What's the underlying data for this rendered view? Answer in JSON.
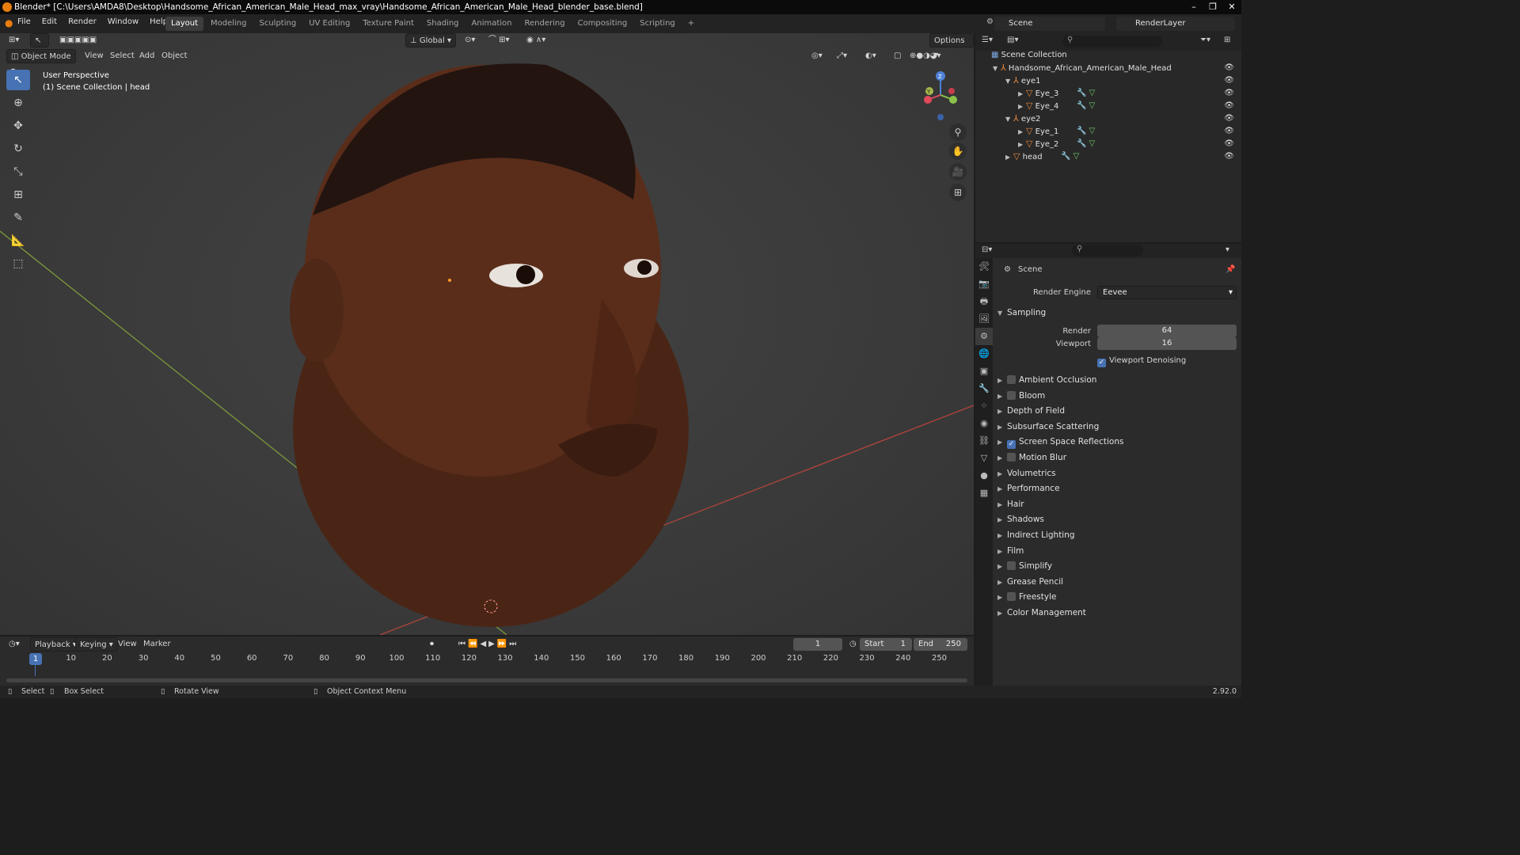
{
  "window": {
    "title": "Blender* [C:\\Users\\AMDA8\\Desktop\\Handsome_African_American_Male_Head_max_vray\\Handsome_African_American_Male_Head_blender_base.blend]"
  },
  "menu": [
    "File",
    "Edit",
    "Render",
    "Window",
    "Help"
  ],
  "workspaces": [
    "Layout",
    "Modeling",
    "Sculpting",
    "UV Editing",
    "Texture Paint",
    "Shading",
    "Animation",
    "Rendering",
    "Compositing",
    "Scripting"
  ],
  "scene_name": "Scene",
  "render_layer": "RenderLayer",
  "viewport": {
    "mode": "Object Mode",
    "menus": [
      "View",
      "Select",
      "Add",
      "Object"
    ],
    "transform_orientation": "Global",
    "options_label": "Options",
    "info_line1": "User Perspective",
    "info_line2": "(1) Scene Collection | head"
  },
  "outliner": {
    "root": "Scene Collection",
    "rows": [
      {
        "label": "Handsome_African_American_Male_Head"
      },
      {
        "label": "eye1"
      },
      {
        "label": "Eye_3"
      },
      {
        "label": "Eye_4"
      },
      {
        "label": "eye2"
      },
      {
        "label": "Eye_1"
      },
      {
        "label": "Eye_2"
      },
      {
        "label": "head"
      }
    ]
  },
  "properties": {
    "context": "Scene",
    "render_engine_label": "Render Engine",
    "render_engine": "Eevee",
    "sampling_label": "Sampling",
    "render_label": "Render",
    "render_value": "64",
    "viewport_label": "Viewport",
    "viewport_value": "16",
    "viewport_denoising": "Viewport Denoising",
    "panels": [
      {
        "label": "Ambient Occlusion",
        "checkbox": true,
        "checked": false
      },
      {
        "label": "Bloom",
        "checkbox": true,
        "checked": false
      },
      {
        "label": "Depth of Field",
        "checkbox": false
      },
      {
        "label": "Subsurface Scattering",
        "checkbox": false
      },
      {
        "label": "Screen Space Reflections",
        "checkbox": true,
        "checked": true
      },
      {
        "label": "Motion Blur",
        "checkbox": true,
        "checked": false
      },
      {
        "label": "Volumetrics",
        "checkbox": false
      },
      {
        "label": "Performance",
        "checkbox": false
      },
      {
        "label": "Hair",
        "checkbox": false
      },
      {
        "label": "Shadows",
        "checkbox": false
      },
      {
        "label": "Indirect Lighting",
        "checkbox": false
      },
      {
        "label": "Film",
        "checkbox": false
      },
      {
        "label": "Simplify",
        "checkbox": true,
        "checked": false
      },
      {
        "label": "Grease Pencil",
        "checkbox": false
      },
      {
        "label": "Freestyle",
        "checkbox": true,
        "checked": false
      },
      {
        "label": "Color Management",
        "checkbox": false
      }
    ]
  },
  "timeline": {
    "menus": [
      "Playback",
      "Keying",
      "View",
      "Marker"
    ],
    "current_frame": "1",
    "start_label": "Start",
    "start": "1",
    "end_label": "End",
    "end": "250",
    "ticks": [
      "10",
      "20",
      "30",
      "40",
      "50",
      "60",
      "70",
      "80",
      "90",
      "100",
      "110",
      "120",
      "130",
      "140",
      "150",
      "160",
      "170",
      "180",
      "190",
      "200",
      "210",
      "220",
      "230",
      "240",
      "250"
    ],
    "playhead": "1"
  },
  "statusbar": {
    "select": "Select",
    "box_select": "Box Select",
    "rotate_view": "Rotate View",
    "context_menu": "Object Context Menu",
    "version": "2.92.0"
  }
}
